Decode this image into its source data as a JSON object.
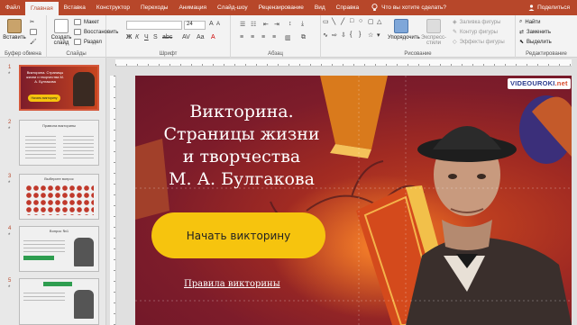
{
  "ribbon": {
    "tabs": [
      "Файл",
      "Главная",
      "Вставка",
      "Конструктор",
      "Переходы",
      "Анимация",
      "Слайд-шоу",
      "Рецензирование",
      "Вид",
      "Справка"
    ],
    "active_tab": "Главная",
    "search_label": "Что вы хотите сделать?",
    "share_label": "Поделиться",
    "groups": {
      "clipboard": {
        "label": "Буфер обмена",
        "paste": "Вставить"
      },
      "slides": {
        "label": "Слайды",
        "new_slide": "Создать слайд",
        "layout": "Макет",
        "reset": "Восстановить",
        "section": "Раздел"
      },
      "font": {
        "label": "Шрифт",
        "size": "24"
      },
      "paragraph": {
        "label": "Абзац"
      },
      "drawing": {
        "label": "Рисование",
        "arrange": "Упорядочить",
        "quick_styles": "Экспресс-стили",
        "fill": "Заливка фигуры",
        "outline": "Контур фигуры",
        "effects": "Эффекты фигуры"
      },
      "editing": {
        "label": "Редактирование",
        "find": "Найти",
        "replace": "Заменить",
        "select": "Выделить"
      }
    }
  },
  "thumbnails": [
    {
      "num": "1",
      "star": "*",
      "title": "Викторина. Страницы жизни и творчества М. А. Булгакова",
      "button": "Начать викторину"
    },
    {
      "num": "2",
      "star": "*",
      "title": "Правила викторины"
    },
    {
      "num": "3",
      "star": "*",
      "title": "Выберите вопрос"
    },
    {
      "num": "4",
      "star": "*",
      "title": "Вопрос №1"
    },
    {
      "num": "5",
      "star": "*",
      "title": ""
    }
  ],
  "slide": {
    "title_lines": [
      "Викторина.",
      "Страницы жизни",
      "и творчества",
      "М. А. Булгакова"
    ],
    "start_button": "Начать викторину",
    "rules_link": "Правила викторины",
    "logo_main": "VIDEOUROKI",
    "logo_suffix": ".net"
  },
  "colors": {
    "ribbon_accent": "#b7472a",
    "slide_dark": "#6b1628",
    "slide_orange": "#c8461f",
    "button_yellow": "#f6c40e"
  }
}
